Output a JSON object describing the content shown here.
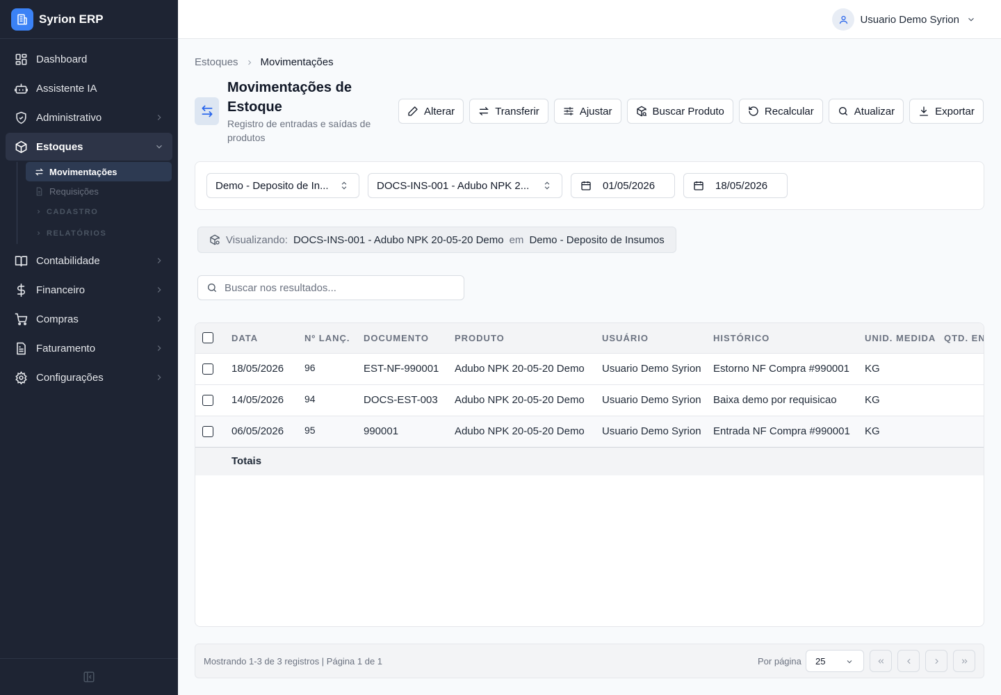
{
  "app": {
    "name": "Syrion ERP"
  },
  "sidebar": {
    "items": [
      {
        "label": "Dashboard",
        "icon": "dashboard-icon"
      },
      {
        "label": "Assistente IA",
        "icon": "bot-icon"
      },
      {
        "label": "Administrativo",
        "icon": "shield-icon"
      },
      {
        "label": "Estoques",
        "icon": "package-icon"
      },
      {
        "label": "Contabilidade",
        "icon": "book-icon"
      },
      {
        "label": "Financeiro",
        "icon": "dollar-icon"
      },
      {
        "label": "Compras",
        "icon": "cart-icon"
      },
      {
        "label": "Faturamento",
        "icon": "invoice-icon"
      },
      {
        "label": "Configurações",
        "icon": "gear-icon"
      }
    ],
    "estoques_sub": [
      {
        "label": "Movimentações"
      },
      {
        "label": "Requisições"
      }
    ],
    "sections": [
      "CADASTRO",
      "RELATÓRIOS"
    ]
  },
  "header": {
    "user_name": "Usuario Demo Syrion"
  },
  "breadcrumb": {
    "parent": "Estoques",
    "current": "Movimentações"
  },
  "page": {
    "title": "Movimentações de Estoque",
    "subtitle": "Registro de entradas e saídas de produtos"
  },
  "actions": {
    "alterar": "Alterar",
    "transferir": "Transferir",
    "ajustar": "Ajustar",
    "buscar_produto": "Buscar Produto",
    "recalcular": "Recalcular",
    "atualizar": "Atualizar",
    "exportar": "Exportar"
  },
  "filters": {
    "deposito": "Demo - Deposito de In...",
    "produto": "DOCS-INS-001 - Adubo NPK 2...",
    "date_from": "01/05/2026",
    "date_to": "18/05/2026"
  },
  "viewing": {
    "label": "Visualizando:",
    "product": "DOCS-INS-001 - Adubo NPK 20-05-20 Demo",
    "connector": "em",
    "deposit": "Demo - Deposito de Insumos"
  },
  "search": {
    "placeholder": "Buscar nos resultados..."
  },
  "table": {
    "columns": [
      "Data",
      "Nº Lanç.",
      "Documento",
      "Produto",
      "Usuário",
      "Histórico",
      "Unid. Medida",
      "Qtd. Entrada"
    ],
    "rows": [
      {
        "data": "18/05/2026",
        "lanc": "96",
        "documento": "EST-NF-990001",
        "produto": "Adubo NPK 20-05-20 Demo",
        "usuario": "Usuario Demo Syrion",
        "historico": "Estorno NF Compra #990001",
        "unid": "KG"
      },
      {
        "data": "14/05/2026",
        "lanc": "94",
        "documento": "DOCS-EST-003",
        "produto": "Adubo NPK 20-05-20 Demo",
        "usuario": "Usuario Demo Syrion",
        "historico": "Baixa demo por requisicao",
        "unid": "KG"
      },
      {
        "data": "06/05/2026",
        "lanc": "95",
        "documento": "990001",
        "produto": "Adubo NPK 20-05-20 Demo",
        "usuario": "Usuario Demo Syrion",
        "historico": "Entrada NF Compra #990001",
        "unid": "KG"
      }
    ],
    "totals_label": "Totais"
  },
  "pagination": {
    "info": "Mostrando 1-3 de 3 registros | Página 1 de 1",
    "per_page_label": "Por página",
    "per_page_value": "25"
  },
  "colors": {
    "sidebar_bg": "#1e2433",
    "accent": "#3b82f6",
    "active_item": "#2d3447"
  }
}
